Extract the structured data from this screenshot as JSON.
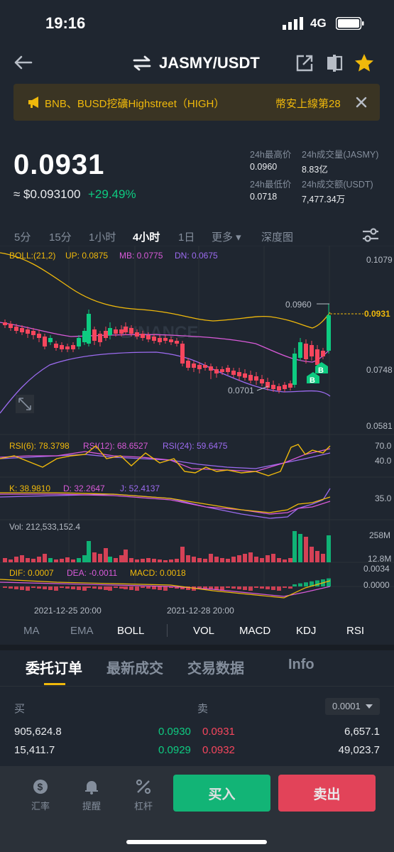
{
  "status": {
    "time": "19:16",
    "network": "4G"
  },
  "header": {
    "pair": "JASMY/USDT"
  },
  "banner": {
    "text": "BNB、BUSD挖礦Highstreet（HIGH）",
    "text_right": "幣安上線第28"
  },
  "ticker": {
    "price": "0.0931",
    "usd_price": "≈ $0.093100",
    "change": "+29.49%",
    "stats": [
      {
        "label": "24h最高价",
        "value": "0.0960"
      },
      {
        "label": "24h成交量(JASMY)",
        "value": "8.83亿"
      },
      {
        "label": "24h最低价",
        "value": "0.0718"
      },
      {
        "label": "24h成交额(USDT)",
        "value": "7,477.34万"
      }
    ]
  },
  "timeframes": [
    "5分",
    "15分",
    "1小时",
    "4小时",
    "1日",
    "更多 ▾",
    "深度图"
  ],
  "active_timeframe": "4小时",
  "chart": {
    "boll_label": "BOLL:(21,2)",
    "boll_up": "UP: 0.0875",
    "boll_mb": "MB: 0.0775",
    "boll_dn": "DN: 0.0675",
    "price_ticks": [
      "0.1079",
      "0.0748",
      "0.0581"
    ],
    "current_price_tag": "0.0931",
    "high_marker": "0.0960",
    "low_marker": "0.0701",
    "watermark": "BINANCE",
    "rsi_labels": [
      "RSI(6): 78.3798",
      "RSI(12): 68.6527",
      "RSI(24): 59.6475"
    ],
    "rsi_ticks": [
      "70.0",
      "40.0"
    ],
    "kdj_labels": [
      "K: 38.9810",
      "D: 32.2647",
      "J: 52.4137"
    ],
    "kdj_ticks": [
      "35.0"
    ],
    "vol_label": "Vol: 212,533,152.4",
    "vol_ticks": [
      "258M",
      "12.8M"
    ],
    "macd_labels": [
      "DIF: 0.0007",
      "DEA: -0.0011",
      "MACD: 0.0018"
    ],
    "macd_ticks": [
      "0.0034",
      "0.0000"
    ],
    "dates": [
      "2021-12-25 20:00",
      "2021-12-28 20:00"
    ],
    "signal_marker": "B",
    "colors": {
      "up": "#0ecb81",
      "down": "#f6465d",
      "boll_up": "#f0b90b",
      "boll_mb": "#d85ad8",
      "boll_dn": "#9c6bf0"
    }
  },
  "indicators": [
    "MA",
    "EMA",
    "BOLL",
    "VOL",
    "MACD",
    "KDJ",
    "RSI"
  ],
  "orderbook": {
    "tabs": [
      "委托订单",
      "最新成交",
      "交易数据",
      "Info"
    ],
    "buy_label": "买",
    "sell_label": "卖",
    "precision": "0.0001",
    "rows": [
      {
        "buy_qty": "905,624.8",
        "buy_price": "0.0930",
        "sell_price": "0.0931",
        "sell_qty": "6,657.1"
      },
      {
        "buy_qty": "15,411.7",
        "buy_price": "0.0929",
        "sell_price": "0.0932",
        "sell_qty": "49,023.7"
      }
    ]
  },
  "bottom": {
    "items": [
      {
        "label": "汇率",
        "icon": "dollar-icon"
      },
      {
        "label": "提醒",
        "icon": "bell-icon"
      },
      {
        "label": "杠杆",
        "icon": "leverage-icon"
      }
    ],
    "buy": "买入",
    "sell": "卖出"
  }
}
